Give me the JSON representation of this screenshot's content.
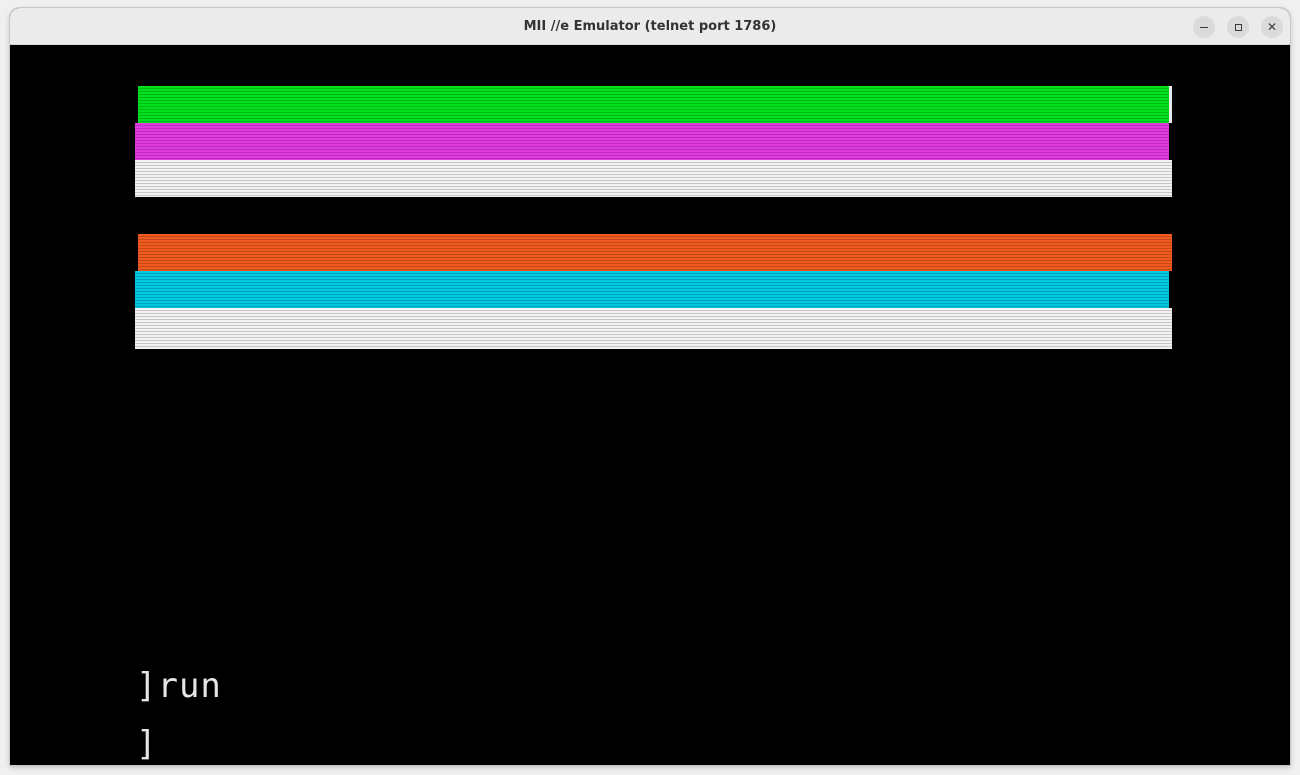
{
  "window": {
    "title": "MII //e Emulator (telnet port 1786)",
    "buttons": {
      "minimize": "minimize-icon",
      "maximize": "maximize-icon",
      "close": "close-icon"
    }
  },
  "screen": {
    "stripes": [
      {
        "name": "green",
        "color": "#00e01c"
      },
      {
        "name": "magenta",
        "color": "#e03ae0"
      },
      {
        "name": "white",
        "color": "#f2f2f2"
      },
      {
        "name": "orange",
        "color": "#f05a1e"
      },
      {
        "name": "cyan",
        "color": "#00c8e0"
      },
      {
        "name": "white",
        "color": "#f2f2f2"
      }
    ],
    "terminal_lines": [
      "]run",
      "]"
    ]
  }
}
